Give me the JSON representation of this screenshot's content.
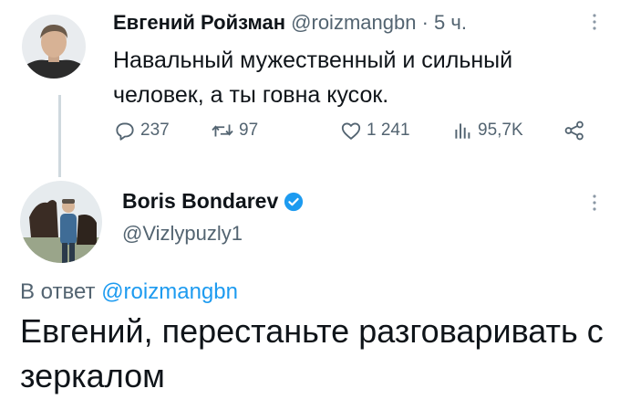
{
  "tweet1": {
    "author_name": "Евгений Ройзман",
    "handle": "@roizmangbn",
    "dot": "·",
    "time": "5 ч.",
    "text": "Навальный мужественный и сильный человек, а ты говна кусок.",
    "stats": {
      "replies": "237",
      "retweets": "97",
      "likes": "1 241",
      "views": "95,7K"
    }
  },
  "tweet2": {
    "author_name": "Boris Bondarev",
    "handle": "@Vizlypuzly1",
    "reply_prefix": "В ответ",
    "reply_mention": "@roizmangbn",
    "text": "Евгений, перестаньте разговаривать с зеркалом"
  },
  "colors": {
    "text": "#0f1419",
    "secondary": "#536471",
    "link": "#1d9bf0",
    "verified": "#1d9bf0",
    "thread_line": "#cfd9de"
  },
  "icons": [
    "reply-icon",
    "retweet-icon",
    "like-icon",
    "views-icon",
    "share-icon",
    "more-icon",
    "verified-badge-icon"
  ]
}
